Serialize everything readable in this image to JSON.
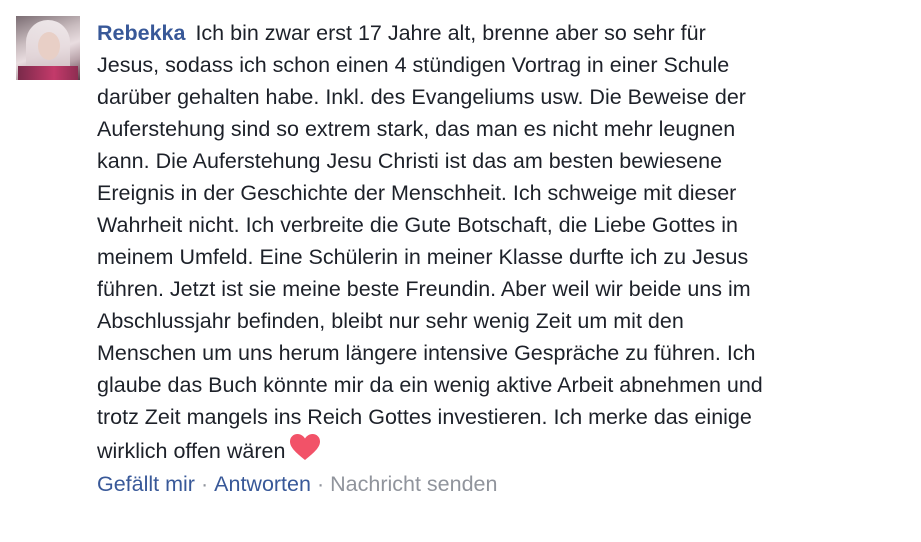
{
  "comment": {
    "author": "Rebekka",
    "lines": [
      "Ich bin zwar erst 17 Jahre alt, brenne aber so sehr für",
      "Jesus, sodass ich schon einen 4 stündigen Vortrag in einer Schule",
      "darüber gehalten habe. Inkl. des Evangeliums usw. Die Beweise der",
      "Auferstehung sind so extrem stark, das man es nicht mehr leugnen",
      "kann. Die Auferstehung Jesu Christi ist das am besten bewiesene",
      "Ereignis in der Geschichte der Menschheit. Ich schweige mit dieser",
      "Wahrheit nicht. Ich verbreite die Gute Botschaft, die Liebe Gottes in",
      "meinem Umfeld. Eine Schülerin in meiner Klasse durfte ich zu Jesus",
      "führen. Jetzt ist sie meine beste Freundin. Aber weil wir beide uns im",
      "Abschlussjahr befinden, bleibt nur sehr wenig Zeit um mit den",
      "Menschen um uns herum längere intensive Gespräche zu führen. Ich",
      "glaube das Buch könnte mir da ein wenig aktive Arbeit abnehmen und",
      "trotz Zeit mangels ins Reich Gottes investieren. Ich merke das einige",
      "wirklich offen wären"
    ],
    "emoji_icon": "heart-emoji-icon"
  },
  "actions": {
    "like": "Gefällt mir",
    "reply": "Antworten",
    "message": "Nachricht senden",
    "separator": "·"
  },
  "colors": {
    "author": "#385898",
    "text": "#1d2129",
    "muted": "#90949c",
    "heart": "#f25268"
  }
}
